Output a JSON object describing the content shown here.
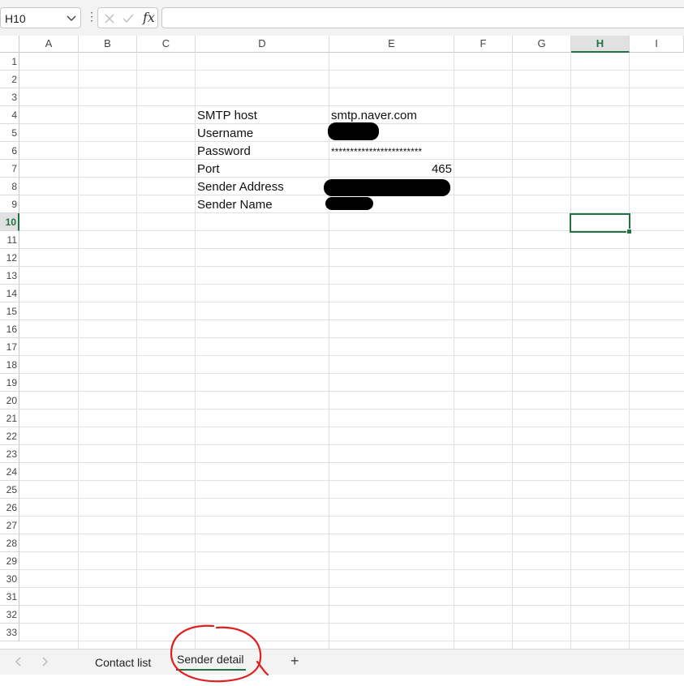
{
  "formula_bar": {
    "name_box": "H10",
    "more_icon": "⋮",
    "cancel_icon": "close-icon",
    "enter_icon": "check-icon",
    "fx_label": "fx",
    "formula": ""
  },
  "columns": [
    "A",
    "B",
    "C",
    "D",
    "E",
    "F",
    "G",
    "H",
    "I"
  ],
  "selected_column": "H",
  "rows": [
    "1",
    "2",
    "3",
    "4",
    "5",
    "6",
    "7",
    "8",
    "9",
    "10",
    "11",
    "12",
    "13",
    "14",
    "15",
    "16",
    "17",
    "18",
    "19",
    "20",
    "21",
    "22",
    "23",
    "24",
    "25",
    "26",
    "27",
    "28",
    "29",
    "30",
    "31",
    "32",
    "33"
  ],
  "selected_row": "10",
  "selected_cell": "H10",
  "cells": {
    "D4": "SMTP host",
    "E4": "smtp.naver.com",
    "D5": "Username",
    "D6": "Password",
    "E6": "************************",
    "D7": "Port",
    "E7": "465",
    "D8": "Sender Address",
    "D9": "Sender Name"
  },
  "redacted_cells": [
    "E5",
    "E8",
    "E9"
  ],
  "sheet_tabs": [
    {
      "label": "Contact list",
      "active": false
    },
    {
      "label": "Sender detail",
      "active": true
    }
  ],
  "add_sheet_label": "+",
  "colors": {
    "accent": "#217346",
    "annotation": "#e02020"
  }
}
